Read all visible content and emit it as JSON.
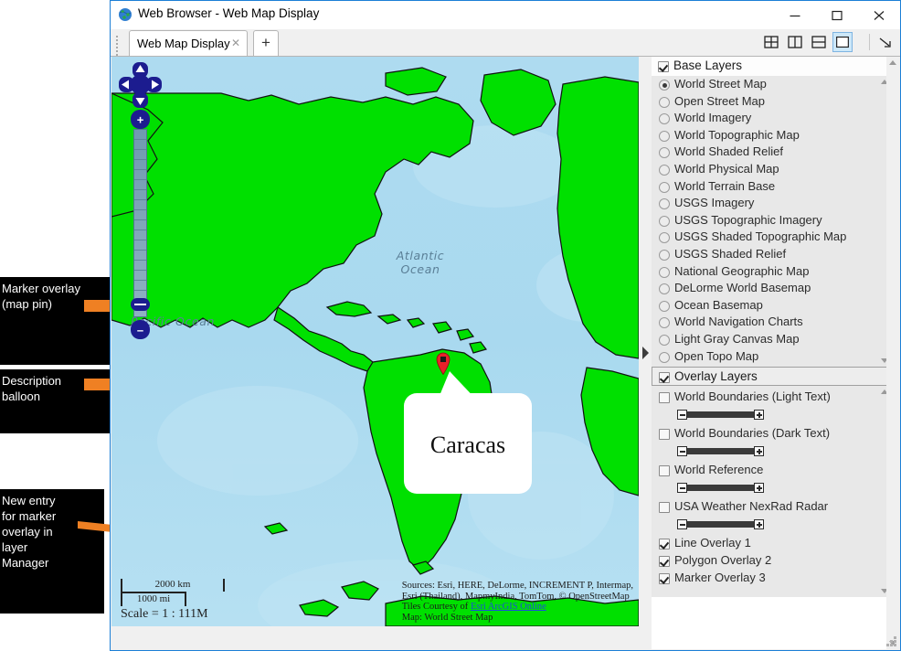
{
  "window": {
    "title": "Web Browser - Web Map Display",
    "icon": "globe-icon",
    "minimize_label": "Minimize",
    "maximize_label": "Maximize",
    "close_label": "Close"
  },
  "tabs": {
    "active_tab_label": "Web Map Display",
    "close_glyph": "✕",
    "new_tab_glyph": "+",
    "layout_buttons": [
      {
        "name": "layout-grid-2x2",
        "selected": false
      },
      {
        "name": "layout-split-vertical",
        "selected": false
      },
      {
        "name": "layout-split-horizontal",
        "selected": false
      },
      {
        "name": "layout-single",
        "selected": true
      }
    ],
    "undock_label": "Undock"
  },
  "map": {
    "ocean_labels": [
      {
        "text": "Atlantic\nOcean",
        "line1": "Atlantic",
        "line2": "Ocean"
      },
      {
        "text": "Pacific Ocean"
      }
    ],
    "pacific_label": "Pacific Ocean",
    "atlantic_label_line1": "Atlantic",
    "atlantic_label_line2": "Ocean",
    "balloon_text": "Caracas",
    "marker_color": "#e8212a",
    "land_color": "#00e000",
    "water_color": "#aadaf0",
    "scale": {
      "km_label": "2000 km",
      "mi_label": "1000 mi",
      "scale_text": "Scale = 1 : 111M"
    },
    "attribution": {
      "line1": "Sources: Esri, HERE, DeLorme, INCREMENT P, Intermap,",
      "line2": "Esri (Thailand), MapmyIndia, TomTom, © OpenStreetMap",
      "line3_prefix": "Tiles Courtesy of ",
      "line3_link": "Esri ArcGIS Online",
      "line4": "Map: World Street Map"
    },
    "zoom_controls": {
      "zoom_in_glyph": "+",
      "zoom_out_glyph": "–",
      "pan_up": "pan-up",
      "pan_down": "pan-down",
      "pan_left": "pan-left",
      "pan_right": "pan-right"
    }
  },
  "layer_manager": {
    "base_layers": {
      "label": "Base Layers",
      "checked": true,
      "selected_item": "World Street Map",
      "items": [
        {
          "label": "World Street Map",
          "selected": true
        },
        {
          "label": "Open Street Map",
          "selected": false
        },
        {
          "label": "World Imagery",
          "selected": false
        },
        {
          "label": "World Topographic Map",
          "selected": false
        },
        {
          "label": "World Shaded Relief",
          "selected": false
        },
        {
          "label": "World Physical Map",
          "selected": false
        },
        {
          "label": "World Terrain Base",
          "selected": false
        },
        {
          "label": "USGS Imagery",
          "selected": false
        },
        {
          "label": "USGS Topographic Imagery",
          "selected": false
        },
        {
          "label": "USGS Shaded Topographic Map",
          "selected": false
        },
        {
          "label": "USGS Shaded Relief",
          "selected": false
        },
        {
          "label": "National Geographic Map",
          "selected": false
        },
        {
          "label": "DeLorme World Basemap",
          "selected": false
        },
        {
          "label": "Ocean Basemap",
          "selected": false
        },
        {
          "label": "World Navigation Charts",
          "selected": false
        },
        {
          "label": "Light Gray Canvas Map",
          "selected": false
        },
        {
          "label": "Open Topo Map",
          "selected": false
        }
      ]
    },
    "overlay_layers": {
      "label": "Overlay Layers",
      "checked": true,
      "items": [
        {
          "label": "World Boundaries (Light Text)",
          "checked": false,
          "has_slider": true
        },
        {
          "label": "World Boundaries (Dark Text)",
          "checked": false,
          "has_slider": true
        },
        {
          "label": "World Reference",
          "checked": false,
          "has_slider": true
        },
        {
          "label": "USA Weather NexRad Radar",
          "checked": false,
          "has_slider": true
        },
        {
          "label": "Line Overlay 1",
          "checked": true,
          "has_slider": false
        },
        {
          "label": "Polygon Overlay 2",
          "checked": true,
          "has_slider": false
        },
        {
          "label": "Marker Overlay 3",
          "checked": true,
          "has_slider": false
        }
      ],
      "slider_minus_glyph": "–",
      "slider_plus_glyph": "+"
    }
  },
  "annotations": [
    {
      "id": "marker-overlay",
      "lines": [
        "Marker overlay",
        "(map pin)"
      ]
    },
    {
      "id": "description-balloon",
      "lines": [
        "Description",
        "balloon"
      ]
    },
    {
      "id": "new-entry",
      "lines": [
        "New entry",
        "for marker",
        "overlay in",
        "layer",
        "Manager"
      ]
    }
  ],
  "colors": {
    "annotation_bg": "#000000",
    "annotation_fg": "#ffffff",
    "arrow": "#ef8023",
    "window_border": "#1c7fd6",
    "selected_layout": "#cde8f9"
  }
}
